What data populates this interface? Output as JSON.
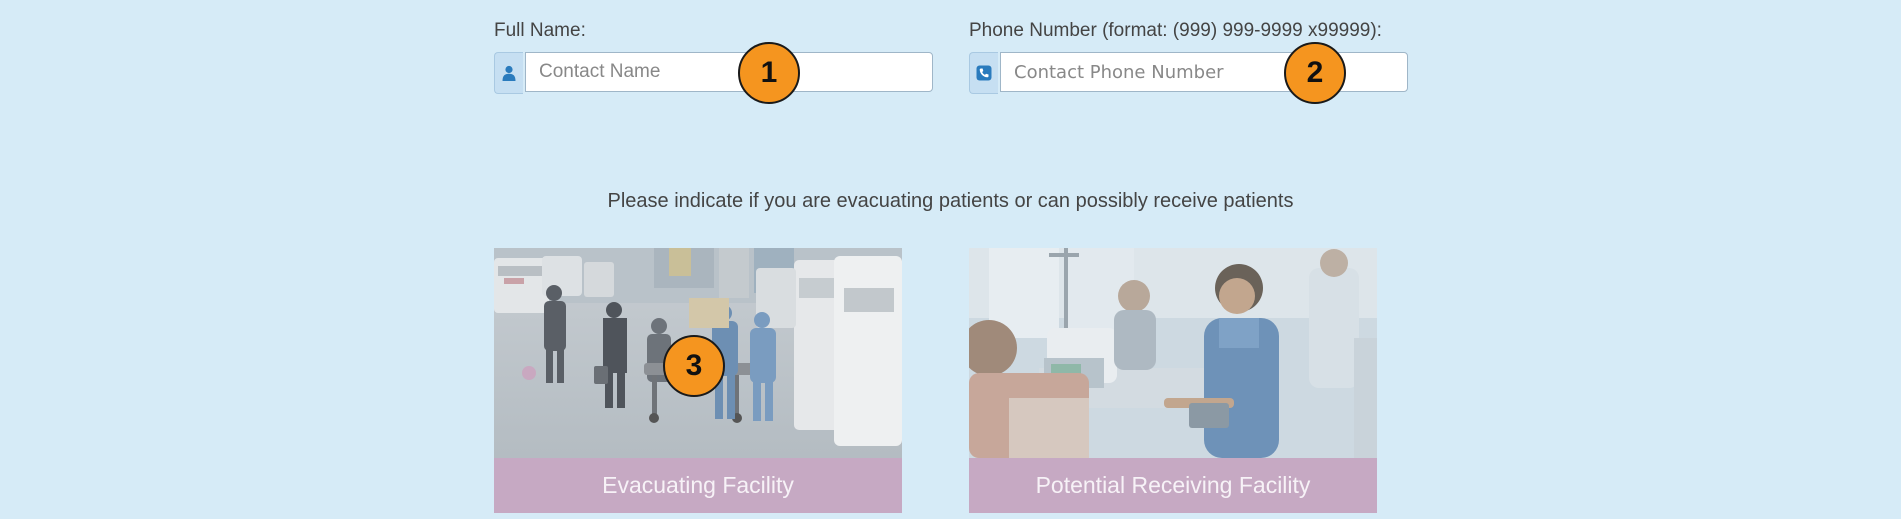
{
  "form": {
    "full_name": {
      "label": "Full Name:",
      "placeholder": "Contact Name",
      "icon": "user-icon"
    },
    "phone": {
      "label": "Phone Number (format: (999) 999-9999 x99999):",
      "placeholder": "Contact Phone Number",
      "icon": "phone-icon"
    }
  },
  "prompt": "Please indicate if you are evacuating patients or can possibly receive patients",
  "cards": [
    {
      "caption": "Evacuating Facility",
      "image": "ambulance-street-photo"
    },
    {
      "caption": "Potential Receiving Facility",
      "image": "nurse-patient-photo"
    }
  ],
  "markers": [
    "1",
    "2",
    "3"
  ],
  "colors": {
    "background": "#d6ebf7",
    "caption_bg": "#c6a9c3",
    "marker": "#f5951f",
    "icon": "#2a7bbd"
  }
}
